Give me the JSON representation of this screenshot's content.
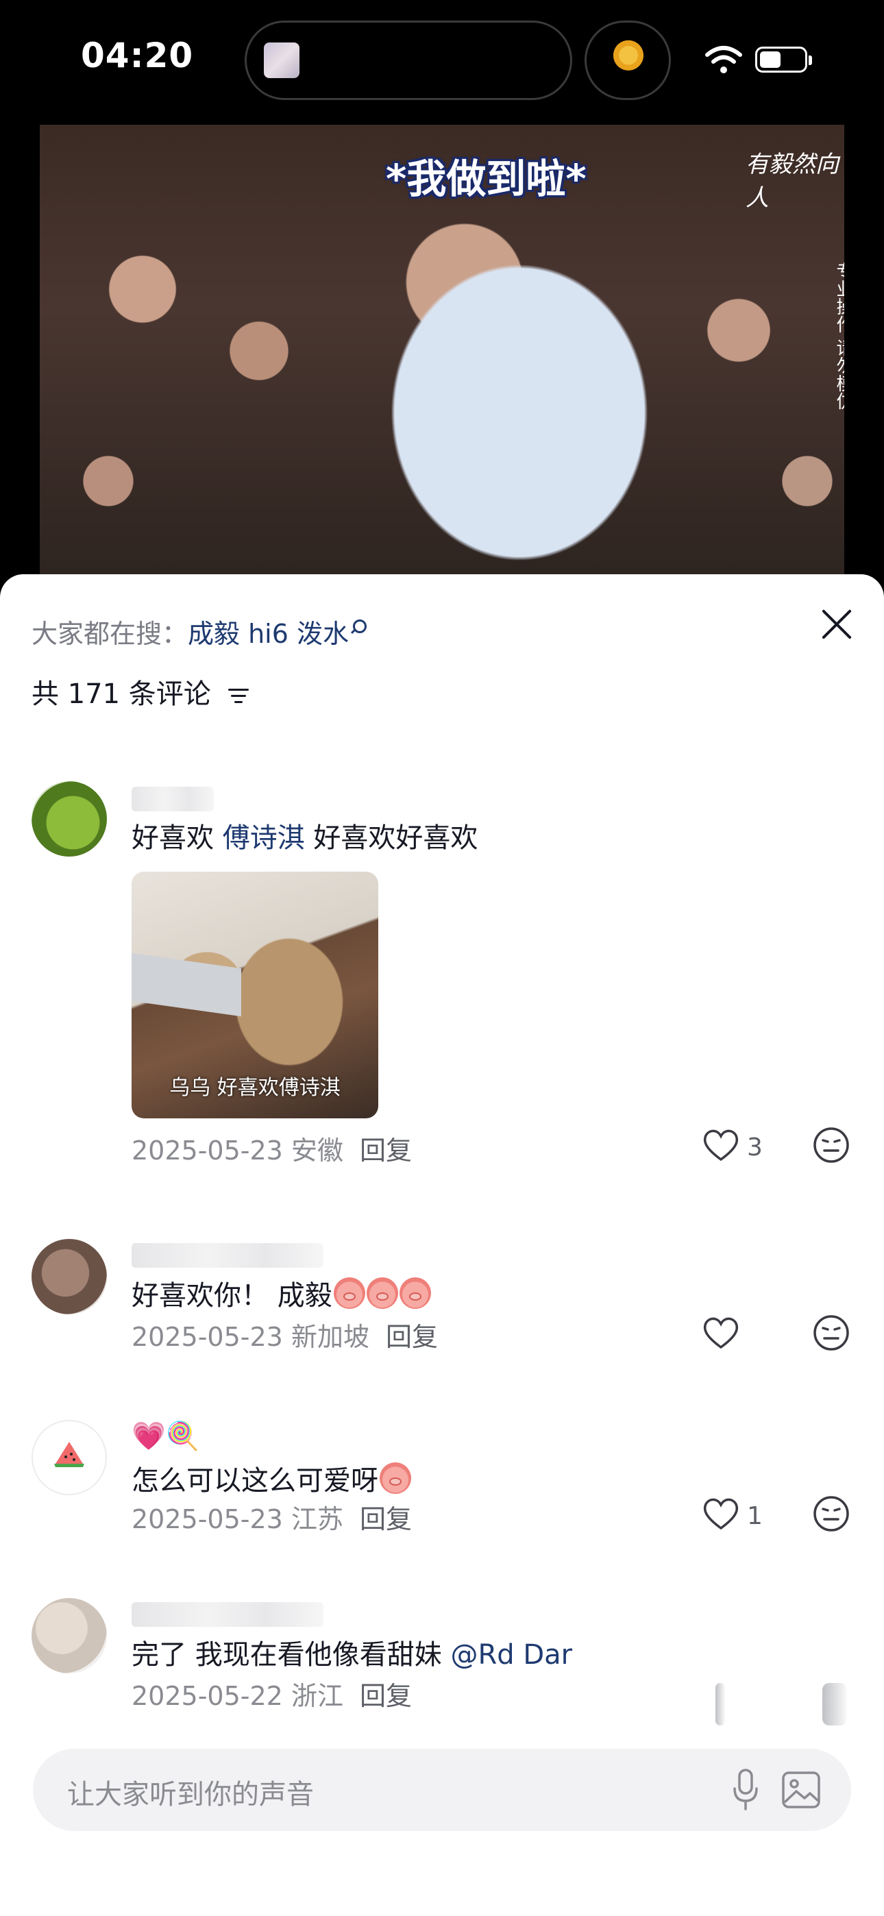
{
  "status_bar": {
    "time": "04:20"
  },
  "video": {
    "caption": "*我做到啦*",
    "logo": "有毅然向人",
    "watermark": "专业操作 请勿模仿"
  },
  "sheet": {
    "search_prefix": "大家都在搜：",
    "search_keyword": "成毅 hi6 泼水",
    "comment_count": "共 171 条评论"
  },
  "comments": [
    {
      "text_a": "好喜欢 ",
      "mention": "傅诗淇",
      "text_b": " 好喜欢好喜欢",
      "image_caption": "乌乌 好喜欢傅诗淇",
      "date": "2025-05-23",
      "location": "安徽",
      "reply": "回复",
      "likes": "3"
    },
    {
      "text": "好喜欢你！ 成毅",
      "date": "2025-05-23",
      "location": "新加坡",
      "reply": "回复",
      "likes": ""
    },
    {
      "name": "💗🍭",
      "text": "怎么可以这么可爱呀",
      "date": "2025-05-23",
      "location": "江苏",
      "reply": "回复",
      "likes": "1"
    },
    {
      "text_a": "完了 我现在看他像看甜妹 ",
      "mention": "@Rd Dar",
      "date": "2025-05-22",
      "location": "浙江",
      "reply": "回复"
    }
  ],
  "input": {
    "placeholder": "让大家听到你的声音"
  },
  "icons": {
    "close": "close-icon",
    "sort": "sort-icon",
    "like": "heart-outline-icon",
    "dislike": "neutral-face-icon",
    "mic": "microphone-icon",
    "image": "image-icon",
    "search": "search-icon"
  },
  "colors": {
    "link": "#1e3a70",
    "meta": "#8a8b91",
    "text": "#161823"
  }
}
